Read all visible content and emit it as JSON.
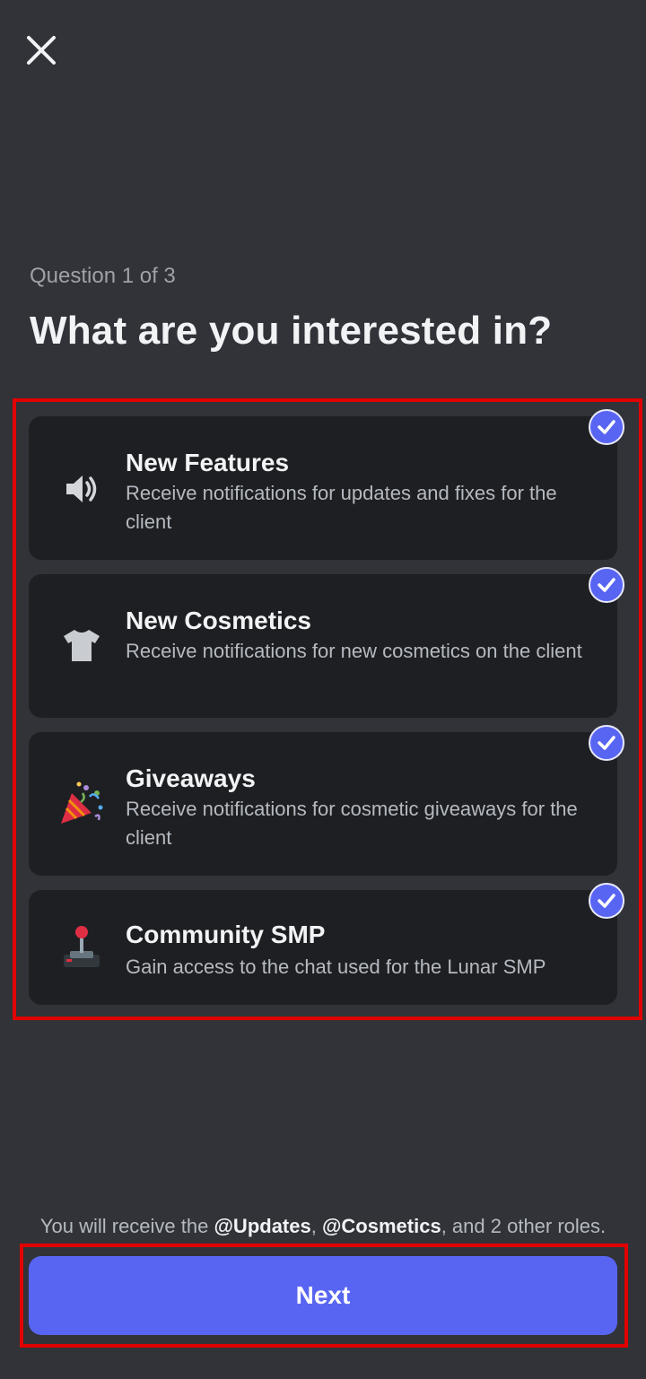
{
  "header": {
    "close_icon": "close-icon"
  },
  "question": {
    "progress": "Question 1 of 3",
    "title": "What are you interested in?"
  },
  "options": [
    {
      "title": "New Features",
      "description": "Receive notifications for updates and fixes for the client",
      "icon": "speaker-icon",
      "selected": true
    },
    {
      "title": "New Cosmetics",
      "description": "Receive notifications for new cosmetics on the client",
      "icon": "tshirt-icon",
      "selected": true
    },
    {
      "title": "Giveaways",
      "description": "Receive notifications for cosmetic giveaways for the client",
      "icon": "party-popper-icon",
      "selected": true
    },
    {
      "title": "Community SMP",
      "description": "Gain access to the chat used for the Lunar SMP",
      "icon": "joystick-icon",
      "selected": true
    }
  ],
  "roles_note": {
    "prefix": "You will receive the ",
    "role1": "@Updates",
    "sep": ", ",
    "role2": "@Cosmetics",
    "suffix": ", and 2 other roles."
  },
  "footer": {
    "next_label": "Next"
  },
  "colors": {
    "background": "#313338",
    "card": "#1e1f22",
    "accent": "#5865f2",
    "highlight": "#e00000"
  }
}
